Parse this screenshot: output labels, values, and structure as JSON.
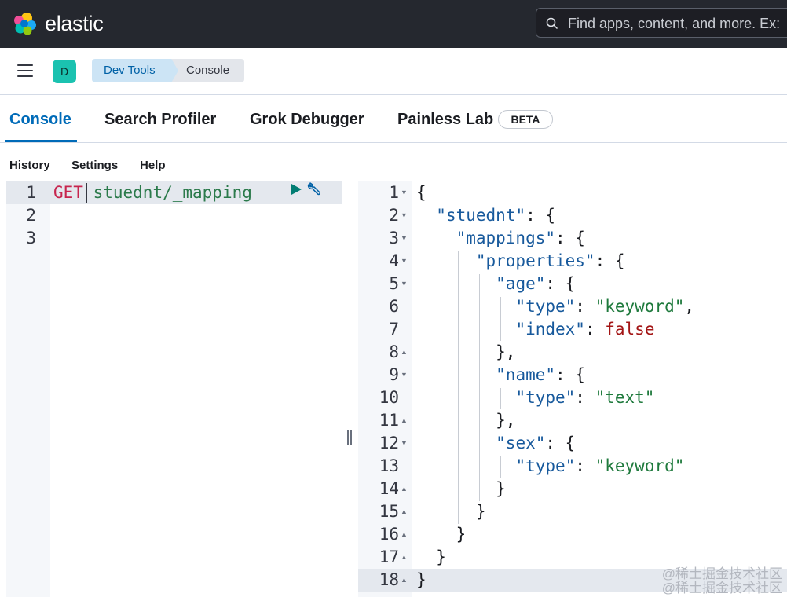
{
  "header": {
    "brand": "elastic",
    "search_placeholder": "Find apps, content, and more. Ex:"
  },
  "breadcrumb": {
    "avatar_letter": "D",
    "items": [
      "Dev Tools",
      "Console"
    ]
  },
  "tabs": [
    {
      "label": "Console",
      "active": true
    },
    {
      "label": "Search Profiler"
    },
    {
      "label": "Grok Debugger"
    },
    {
      "label": "Painless Lab"
    }
  ],
  "tab_badge": "BETA",
  "menu": [
    "History",
    "Settings",
    "Help"
  ],
  "request": {
    "line_numbers": [
      "1",
      "2",
      "3"
    ],
    "method": "GET",
    "path": "stuednt/_mapping"
  },
  "response": {
    "line_numbers": [
      "1",
      "2",
      "3",
      "4",
      "5",
      "6",
      "7",
      "8",
      "9",
      "10",
      "11",
      "12",
      "13",
      "14",
      "15",
      "16",
      "17",
      "18"
    ],
    "index_key": "\"stuednt\"",
    "mappings_key": "\"mappings\"",
    "properties_key": "\"properties\"",
    "field1_key": "\"age\"",
    "type_key": "\"type\"",
    "keyword_value": "\"keyword\"",
    "index_key2": "\"index\"",
    "false_value": "false",
    "field2_key": "\"name\"",
    "text_value": "\"text\"",
    "field3_key": "\"sex\""
  },
  "watermark": [
    "@稀土掘金技术社区",
    "@稀土掘金技术社区"
  ],
  "colors": {
    "header_bg": "#25282f",
    "accent": "#006bb8",
    "breadcrumb_active": "#cce4f5",
    "avatar": "#1bc2b0",
    "method": "#c7254e",
    "json_key": "#17599c",
    "json_string": "#1f7a3d",
    "json_boolean": "#a31515"
  },
  "icons": [
    "elastic-logo-icon",
    "search-icon",
    "menu-icon",
    "play-icon",
    "wrench-icon",
    "resize-handle-icon"
  ]
}
